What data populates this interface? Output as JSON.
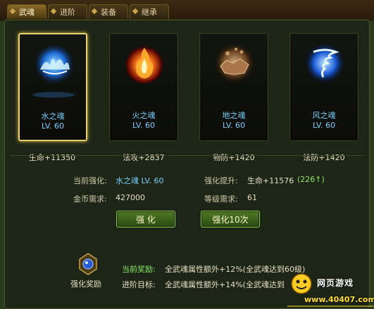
{
  "tabs": [
    {
      "label": "武魂",
      "active": true
    },
    {
      "label": "进阶",
      "active": false
    },
    {
      "label": "装备",
      "active": false
    },
    {
      "label": "继承",
      "active": false
    }
  ],
  "souls": [
    {
      "name": "水之魂",
      "level": "LV. 60",
      "stat": "生命+11350",
      "icon": "water-soul-icon",
      "color": "#3aa0ff",
      "selected": true
    },
    {
      "name": "火之魂",
      "level": "LV. 60",
      "stat": "法攻+2837",
      "icon": "fire-soul-icon",
      "color": "#ff6a1a",
      "selected": false
    },
    {
      "name": "地之魂",
      "level": "LV. 60",
      "stat": "物防+1420",
      "icon": "earth-soul-icon",
      "color": "#b07a4a",
      "selected": false
    },
    {
      "name": "风之魂",
      "level": "LV. 60",
      "stat": "法防+1420",
      "icon": "wind-soul-icon",
      "color": "#3a8cff",
      "selected": false
    }
  ],
  "enhance": {
    "current_label": "当前强化:",
    "current_value": "水之魂 LV. 60",
    "boost_label": "强化提升:",
    "boost_value": "生命+11576",
    "boost_delta": "(226↑)",
    "gold_label": "金币需求:",
    "gold_value": "427000",
    "level_label": "等级需求:",
    "level_value": "61",
    "btn_once": "强 化",
    "btn_ten": "强化10次"
  },
  "reward": {
    "label": "强化奖励",
    "current_prefix": "当前奖励:",
    "current_text": "全武魂属性额外+12%(全武魂达到60级)",
    "next_prefix": "进阶目标:",
    "next_text": "全武魂属性额外+14%(全武魂达到"
  },
  "watermark": {
    "title": "网页游戏",
    "url": "www.40407.com"
  }
}
